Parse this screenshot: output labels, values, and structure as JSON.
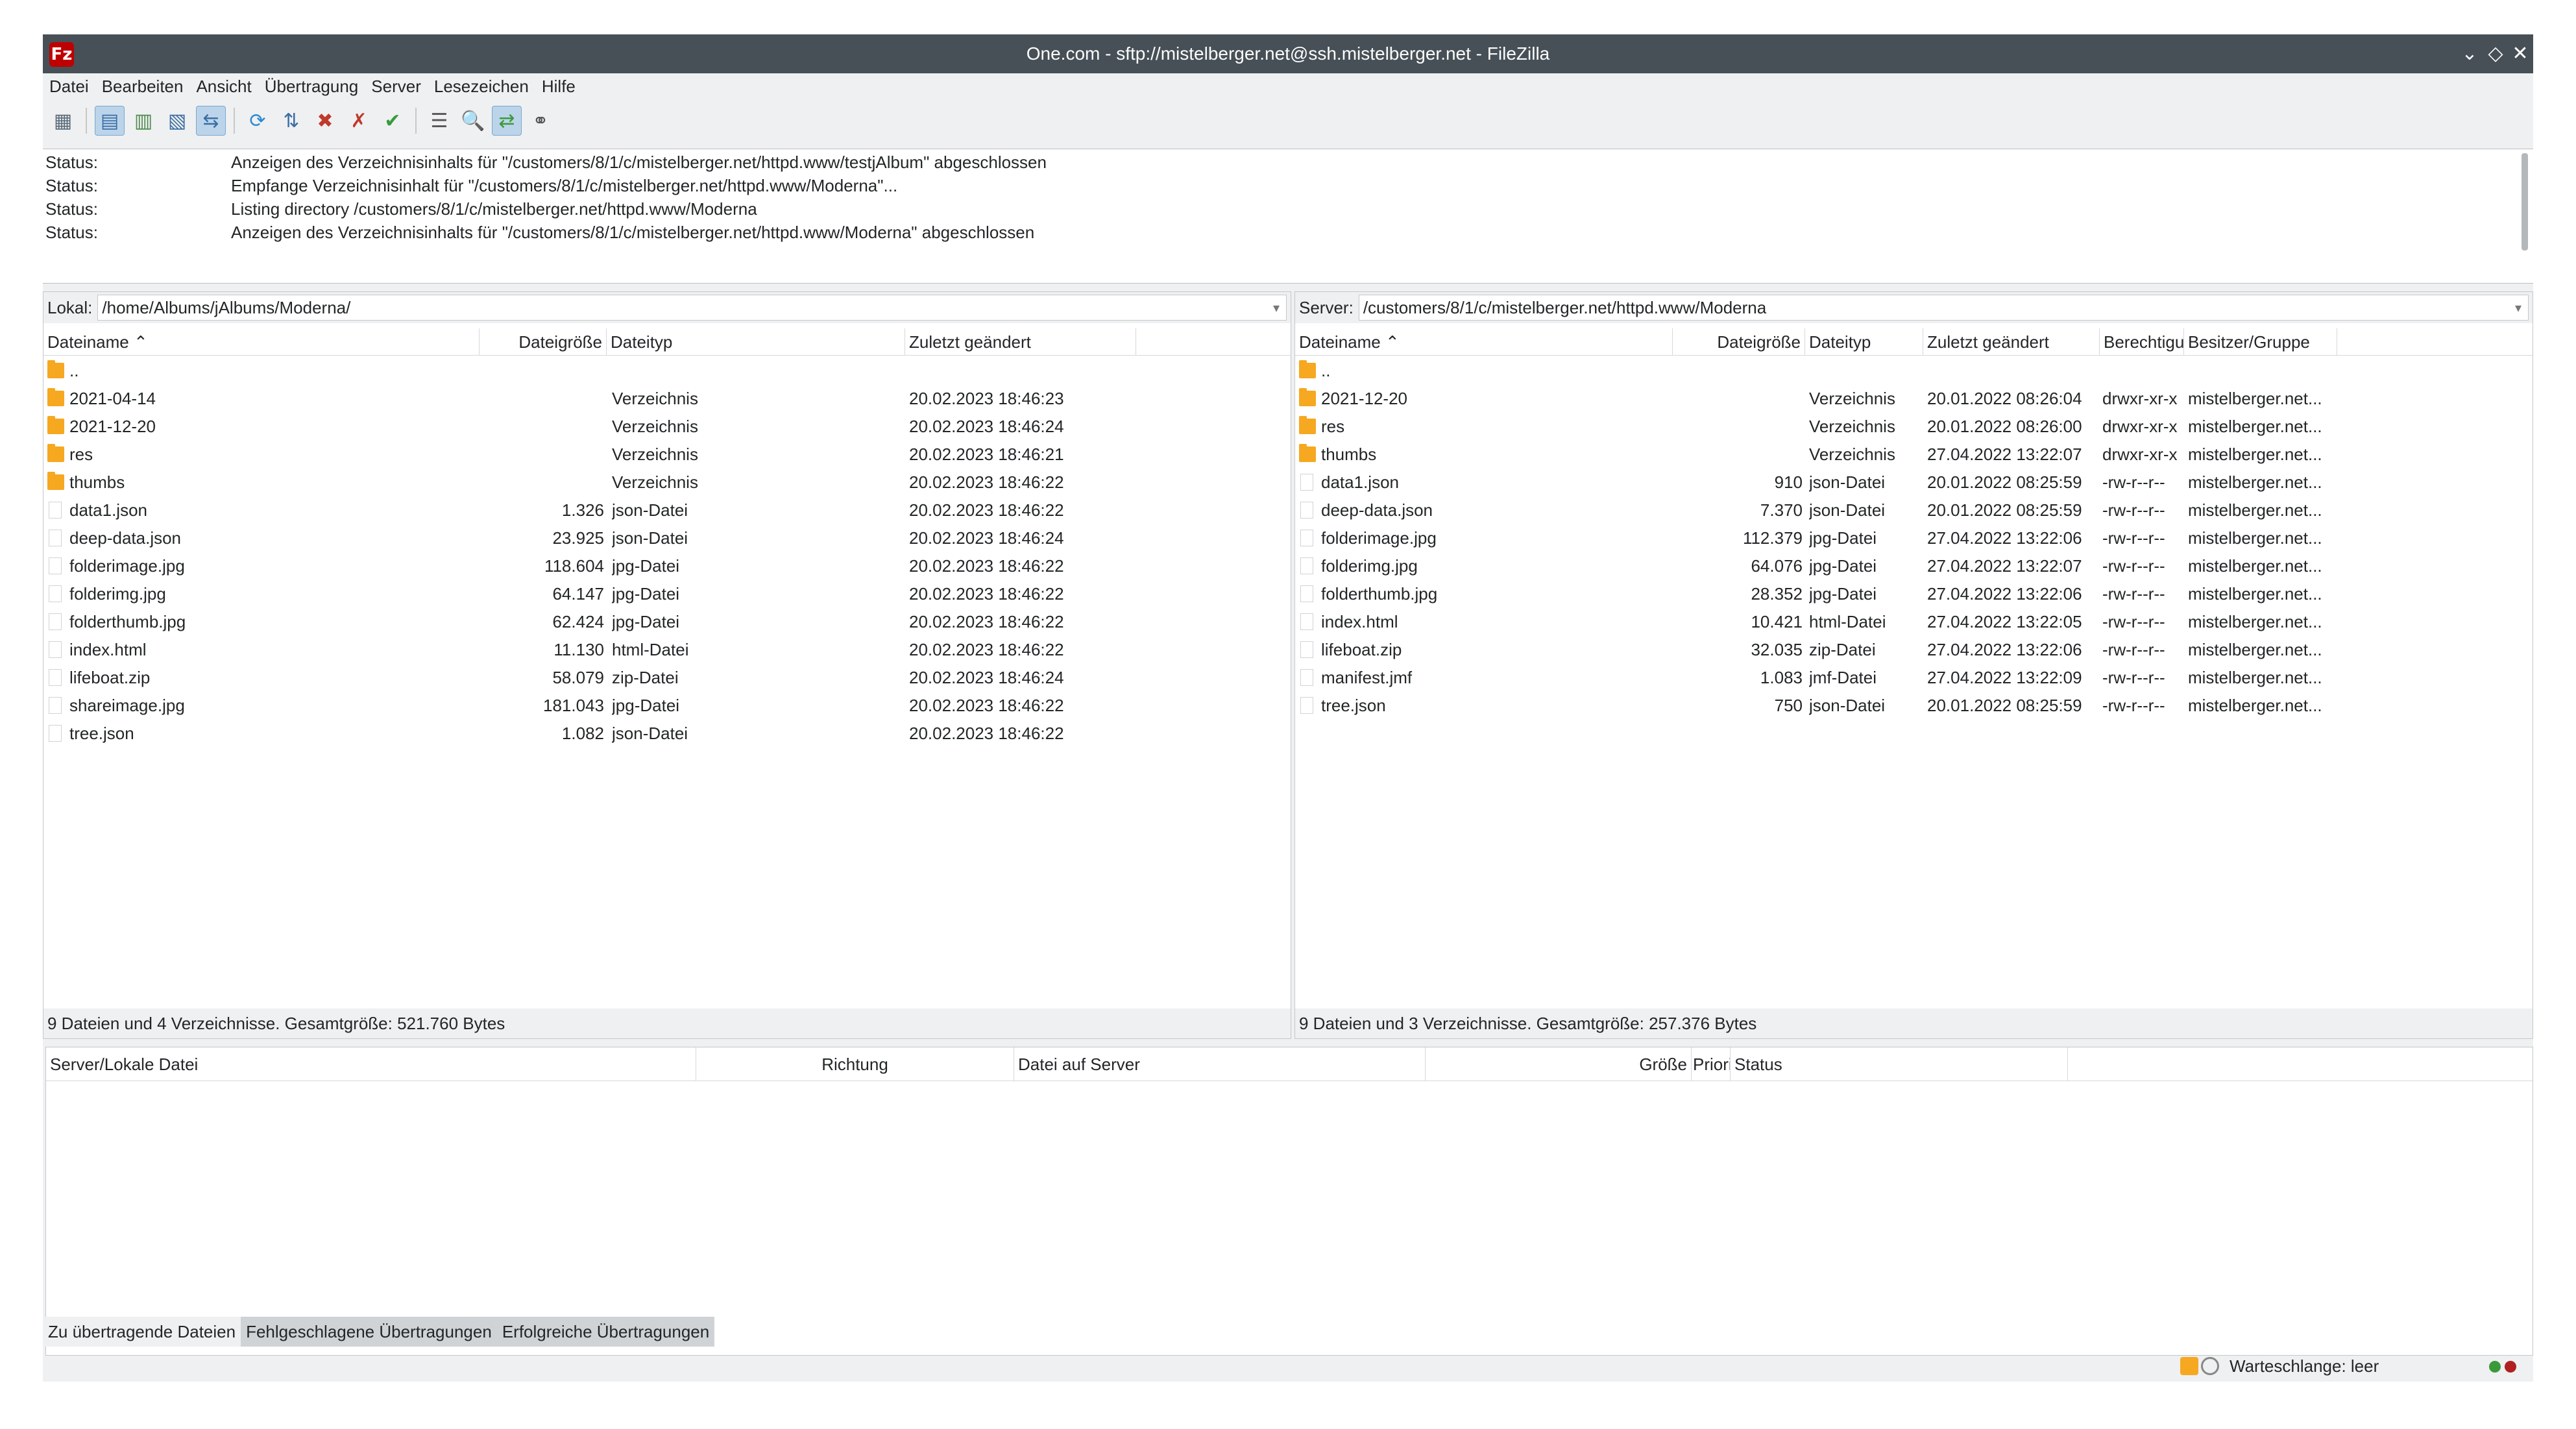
{
  "window": {
    "title": "One.com - sftp://mistelberger.net@ssh.mistelberger.net - FileZilla",
    "app_icon": "Fz",
    "controls": {
      "minimize": "⌄",
      "maximize": "◇",
      "close": "✕"
    }
  },
  "menu": [
    "Datei",
    "Bearbeiten",
    "Ansicht",
    "Übertragung",
    "Server",
    "Lesezeichen",
    "Hilfe"
  ],
  "toolbar": {
    "icons": [
      "site-manager-icon",
      "toggle-log-icon",
      "toggle-local-tree-icon",
      "toggle-remote-tree-icon",
      "toggle-queue-icon",
      "refresh-icon",
      "process-queue-icon",
      "cancel-icon",
      "disconnect-icon",
      "reconnect-icon",
      "directory-listing-filter-icon",
      "toggle-comparison-icon",
      "synchronized-browsing-icon",
      "search-icon"
    ],
    "glyphs": [
      "▦",
      "▤",
      "▥",
      "▧",
      "⇆",
      "⟳",
      "⇅",
      "✖",
      "✗",
      "✔",
      "☰",
      "🔍",
      "⇄",
      "⚭"
    ]
  },
  "log": [
    {
      "key": "Status:",
      "msg": "Anzeigen des Verzeichnisinhalts für \"/customers/8/1/c/mistelberger.net/httpd.www/testjAlbum\" abgeschlossen"
    },
    {
      "key": "Status:",
      "msg": "Empfange Verzeichnisinhalt für \"/customers/8/1/c/mistelberger.net/httpd.www/Moderna\"..."
    },
    {
      "key": "Status:",
      "msg": "Listing directory /customers/8/1/c/mistelberger.net/httpd.www/Moderna"
    },
    {
      "key": "Status:",
      "msg": "Anzeigen des Verzeichnisinhalts für \"/customers/8/1/c/mistelberger.net/httpd.www/Moderna\" abgeschlossen"
    }
  ],
  "local": {
    "path_label": "Lokal:",
    "path": "/home/Albums/jAlbums/Moderna/",
    "columns": {
      "name": "Dateiname ⌃",
      "size": "Dateigröße",
      "type": "Dateityp",
      "modified": "Zuletzt geändert"
    },
    "rows": [
      {
        "kind": "folder",
        "name": "..",
        "size": "",
        "type": "",
        "modified": ""
      },
      {
        "kind": "folder",
        "name": "2021-04-14",
        "size": "",
        "type": "Verzeichnis",
        "modified": "20.02.2023 18:46:23"
      },
      {
        "kind": "folder",
        "name": "2021-12-20",
        "size": "",
        "type": "Verzeichnis",
        "modified": "20.02.2023 18:46:24"
      },
      {
        "kind": "folder",
        "name": "res",
        "size": "",
        "type": "Verzeichnis",
        "modified": "20.02.2023 18:46:21"
      },
      {
        "kind": "folder",
        "name": "thumbs",
        "size": "",
        "type": "Verzeichnis",
        "modified": "20.02.2023 18:46:22"
      },
      {
        "kind": "file",
        "name": "data1.json",
        "size": "1.326",
        "type": "json-Datei",
        "modified": "20.02.2023 18:46:22"
      },
      {
        "kind": "file",
        "name": "deep-data.json",
        "size": "23.925",
        "type": "json-Datei",
        "modified": "20.02.2023 18:46:24"
      },
      {
        "kind": "file",
        "name": "folderimage.jpg",
        "size": "118.604",
        "type": "jpg-Datei",
        "modified": "20.02.2023 18:46:22"
      },
      {
        "kind": "file",
        "name": "folderimg.jpg",
        "size": "64.147",
        "type": "jpg-Datei",
        "modified": "20.02.2023 18:46:22"
      },
      {
        "kind": "file",
        "name": "folderthumb.jpg",
        "size": "62.424",
        "type": "jpg-Datei",
        "modified": "20.02.2023 18:46:22"
      },
      {
        "kind": "file",
        "name": "index.html",
        "size": "11.130",
        "type": "html-Datei",
        "modified": "20.02.2023 18:46:22"
      },
      {
        "kind": "file",
        "name": "lifeboat.zip",
        "size": "58.079",
        "type": "zip-Datei",
        "modified": "20.02.2023 18:46:24"
      },
      {
        "kind": "file",
        "name": "shareimage.jpg",
        "size": "181.043",
        "type": "jpg-Datei",
        "modified": "20.02.2023 18:46:22"
      },
      {
        "kind": "file",
        "name": "tree.json",
        "size": "1.082",
        "type": "json-Datei",
        "modified": "20.02.2023 18:46:22"
      }
    ],
    "footer": "9 Dateien und 4 Verzeichnisse. Gesamtgröße: 521.760 Bytes"
  },
  "remote": {
    "path_label": "Server:",
    "path": "/customers/8/1/c/mistelberger.net/httpd.www/Moderna",
    "columns": {
      "name": "Dateiname ⌃",
      "size": "Dateigröße",
      "type": "Dateityp",
      "modified": "Zuletzt geändert",
      "perms": "Berechtigungen",
      "owner": "Besitzer/Gruppe"
    },
    "rows": [
      {
        "kind": "folder",
        "name": "..",
        "size": "",
        "type": "",
        "modified": "",
        "perms": "",
        "owner": ""
      },
      {
        "kind": "folder",
        "name": "2021-12-20",
        "size": "",
        "type": "Verzeichnis",
        "modified": "20.01.2022 08:26:04",
        "perms": "drwxr-xr-x",
        "owner": "mistelberger.net..."
      },
      {
        "kind": "folder",
        "name": "res",
        "size": "",
        "type": "Verzeichnis",
        "modified": "20.01.2022 08:26:00",
        "perms": "drwxr-xr-x",
        "owner": "mistelberger.net..."
      },
      {
        "kind": "folder",
        "name": "thumbs",
        "size": "",
        "type": "Verzeichnis",
        "modified": "27.04.2022 13:22:07",
        "perms": "drwxr-xr-x",
        "owner": "mistelberger.net..."
      },
      {
        "kind": "file",
        "name": "data1.json",
        "size": "910",
        "type": "json-Datei",
        "modified": "20.01.2022 08:25:59",
        "perms": "-rw-r--r--",
        "owner": "mistelberger.net..."
      },
      {
        "kind": "file",
        "name": "deep-data.json",
        "size": "7.370",
        "type": "json-Datei",
        "modified": "20.01.2022 08:25:59",
        "perms": "-rw-r--r--",
        "owner": "mistelberger.net..."
      },
      {
        "kind": "file",
        "name": "folderimage.jpg",
        "size": "112.379",
        "type": "jpg-Datei",
        "modified": "27.04.2022 13:22:06",
        "perms": "-rw-r--r--",
        "owner": "mistelberger.net..."
      },
      {
        "kind": "file",
        "name": "folderimg.jpg",
        "size": "64.076",
        "type": "jpg-Datei",
        "modified": "27.04.2022 13:22:07",
        "perms": "-rw-r--r--",
        "owner": "mistelberger.net..."
      },
      {
        "kind": "file",
        "name": "folderthumb.jpg",
        "size": "28.352",
        "type": "jpg-Datei",
        "modified": "27.04.2022 13:22:06",
        "perms": "-rw-r--r--",
        "owner": "mistelberger.net..."
      },
      {
        "kind": "file",
        "name": "index.html",
        "size": "10.421",
        "type": "html-Datei",
        "modified": "27.04.2022 13:22:05",
        "perms": "-rw-r--r--",
        "owner": "mistelberger.net..."
      },
      {
        "kind": "file",
        "name": "lifeboat.zip",
        "size": "32.035",
        "type": "zip-Datei",
        "modified": "27.04.2022 13:22:06",
        "perms": "-rw-r--r--",
        "owner": "mistelberger.net..."
      },
      {
        "kind": "file",
        "name": "manifest.jmf",
        "size": "1.083",
        "type": "jmf-Datei",
        "modified": "27.04.2022 13:22:09",
        "perms": "-rw-r--r--",
        "owner": "mistelberger.net..."
      },
      {
        "kind": "file",
        "name": "tree.json",
        "size": "750",
        "type": "json-Datei",
        "modified": "20.01.2022 08:25:59",
        "perms": "-rw-r--r--",
        "owner": "mistelberger.net..."
      }
    ],
    "footer": "9 Dateien und 3 Verzeichnisse. Gesamtgröße: 257.376 Bytes"
  },
  "queue": {
    "columns": {
      "server_local": "Server/Lokale Datei",
      "direction": "Richtung",
      "remote_file": "Datei auf Server",
      "size": "Größe",
      "priority": "Priorität",
      "status": "Status"
    }
  },
  "tabs": [
    "Zu übertragende Dateien",
    "Fehlgeschlagene Übertragungen",
    "Erfolgreiche Übertragungen"
  ],
  "statusbar": {
    "queue_text": "Warteschlange: leer",
    "led_colors": [
      "#3a9a3a",
      "#b02020"
    ]
  },
  "colors": {
    "folder": "#f6a821",
    "titlebar": "#475057",
    "app_icon": "#bf0000"
  }
}
